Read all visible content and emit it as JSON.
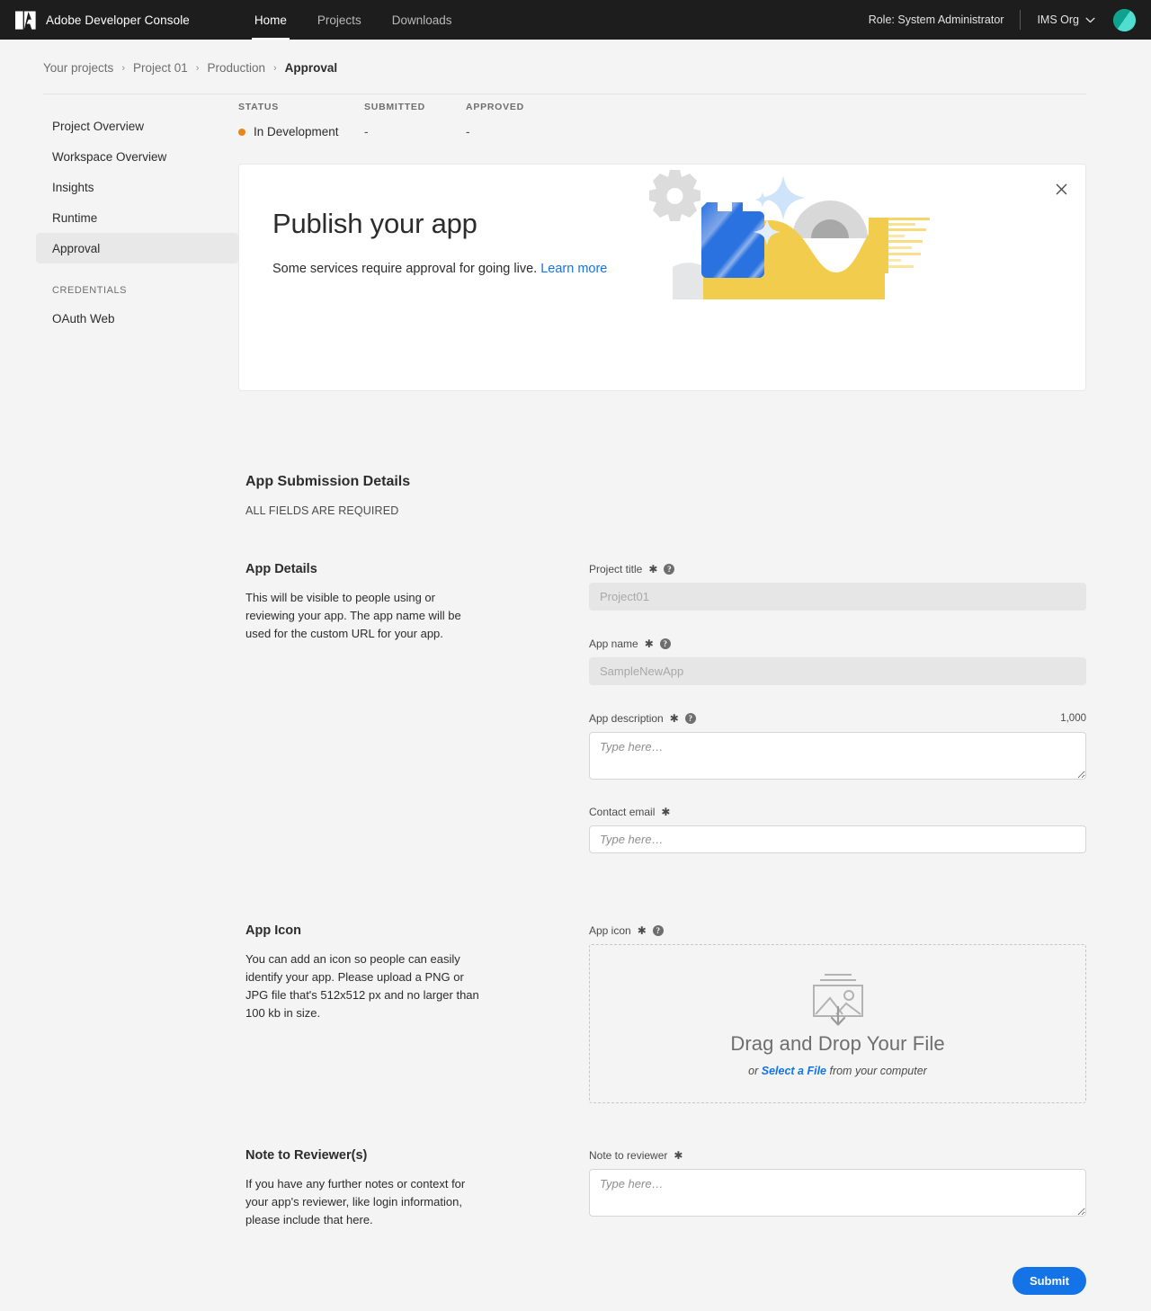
{
  "topbar": {
    "logo_name": "adobe-logo",
    "brand": "Adobe Developer Console",
    "nav": [
      {
        "label": "Home",
        "active": true
      },
      {
        "label": "Projects",
        "active": false
      },
      {
        "label": "Downloads",
        "active": false
      }
    ],
    "role": "Role: System Administrator",
    "org": "IMS Org",
    "avatar_color": "#14b5a0",
    "background": "#1d1d1d"
  },
  "breadcrumb": {
    "items": [
      "Your projects",
      "Project 01",
      "Production",
      "Approval"
    ],
    "separator": "›"
  },
  "sidebar": {
    "items": [
      {
        "label": "Project Overview",
        "selected": false
      },
      {
        "label": "Workspace Overview",
        "selected": false
      },
      {
        "label": "Insights",
        "selected": false
      },
      {
        "label": "Runtime",
        "selected": false
      },
      {
        "label": "Approval",
        "selected": true
      }
    ],
    "section_heading": "CREDENTIALS",
    "credentials": [
      {
        "label": "OAuth Web",
        "selected": false
      }
    ]
  },
  "status": {
    "columns": [
      "STATUS",
      "SUBMITTED",
      "APPROVED"
    ],
    "value": "In Development",
    "dot_color": "#e68619",
    "submitted": "-",
    "approved": "-"
  },
  "banner": {
    "title": "Publish your app",
    "subtitle": "Some services require approval for going live.",
    "link": "Learn more",
    "close_icon": "close-icon"
  },
  "section": {
    "title": "App Submission Details",
    "required_note": "ALL FIELDS ARE REQUIRED"
  },
  "app_details": {
    "heading": "App Details",
    "description": "This will be visible to people using or reviewing your app. The app name will be used for the custom URL for your app.",
    "fields": {
      "project_title": {
        "label": "Project title",
        "required_mark": "✱",
        "value": "Project01",
        "readonly": true
      },
      "app_name": {
        "label": "App name",
        "required_mark": "✱",
        "value": "SampleNewApp",
        "readonly": true
      },
      "app_description": {
        "label": "App description",
        "required_mark": "✱",
        "placeholder": "Type here…",
        "counter": "1,000"
      },
      "contact_email": {
        "label": "Contact email",
        "required_mark": "✱",
        "placeholder": "Type here…"
      }
    }
  },
  "app_icon": {
    "heading": "App Icon",
    "description": "You can add an icon so people can easily identify your app. Please upload a PNG or JPG file that's 512x512 px and no larger than 100 kb in size.",
    "field_label": "App icon",
    "required_mark": "✱",
    "dropzone_title": "Drag and Drop Your File",
    "dropzone_prefix": "or ",
    "dropzone_link": "Select a File",
    "dropzone_suffix": " from your computer"
  },
  "note_reviewer": {
    "heading": "Note to Reviewer(s)",
    "description": "If you have any further notes or context for your app's reviewer, like login information, please include that here.",
    "field_label": "Note to reviewer",
    "required_mark": "✱",
    "placeholder": "Type here…"
  },
  "submit": {
    "label": "Submit",
    "color": "#1473e6"
  },
  "icons": {
    "help": "?"
  }
}
